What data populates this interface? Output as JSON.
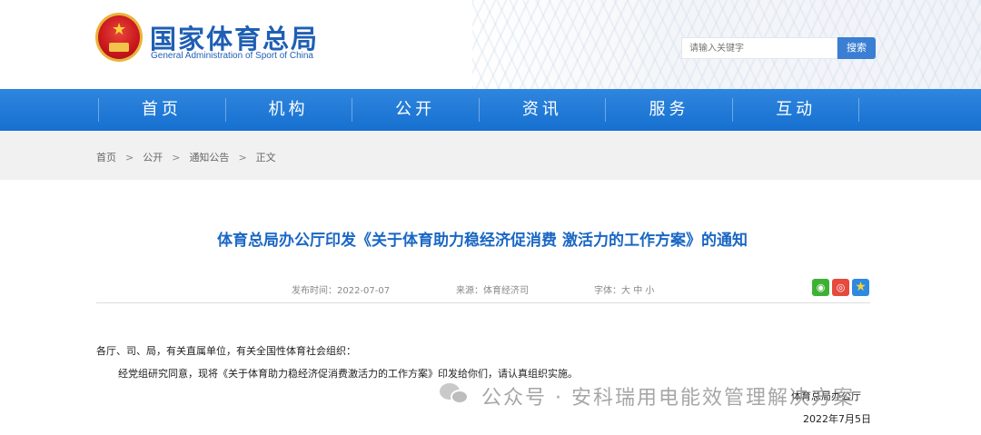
{
  "header": {
    "logo_cn": "国家体育总局",
    "logo_en": "General Administration of Sport of China",
    "search_placeholder": "请输入关键字",
    "search_button": "搜索"
  },
  "nav": {
    "items": [
      "首页",
      "机构",
      "公开",
      "资讯",
      "服务",
      "互动"
    ]
  },
  "breadcrumb": {
    "items": [
      "首页",
      "公开",
      "通知公告",
      "正文"
    ],
    "separator": ">"
  },
  "article": {
    "title": "体育总局办公厅印发《关于体育助力稳经济促消费 激活力的工作方案》的通知",
    "publish_label": "发布时间：",
    "publish_date": "2022-07-07",
    "source_label": "来源：",
    "source": "体育经济司",
    "font_label": "字体：",
    "font_options": [
      "大",
      "中",
      "小"
    ],
    "salutation": "各厅、司、局，有关直属单位，有关全国性体育社会组织：",
    "body": "经党组研究同意，现将《关于体育助力稳经济促消费激活力的工作方案》印发给你们，请认真组织实施。",
    "signature": "体育总局办公厅",
    "sign_date": "2022年7月5日"
  },
  "share": {
    "icons": [
      "wechat-icon",
      "weibo-icon",
      "qzone-icon"
    ]
  },
  "watermark": {
    "text": "公众号 · 安科瑞用电能效管理解决方案"
  },
  "colors": {
    "brand_blue": "#1f5fb4",
    "nav_blue": "#1e78d6",
    "title_blue": "#1a67c4"
  }
}
